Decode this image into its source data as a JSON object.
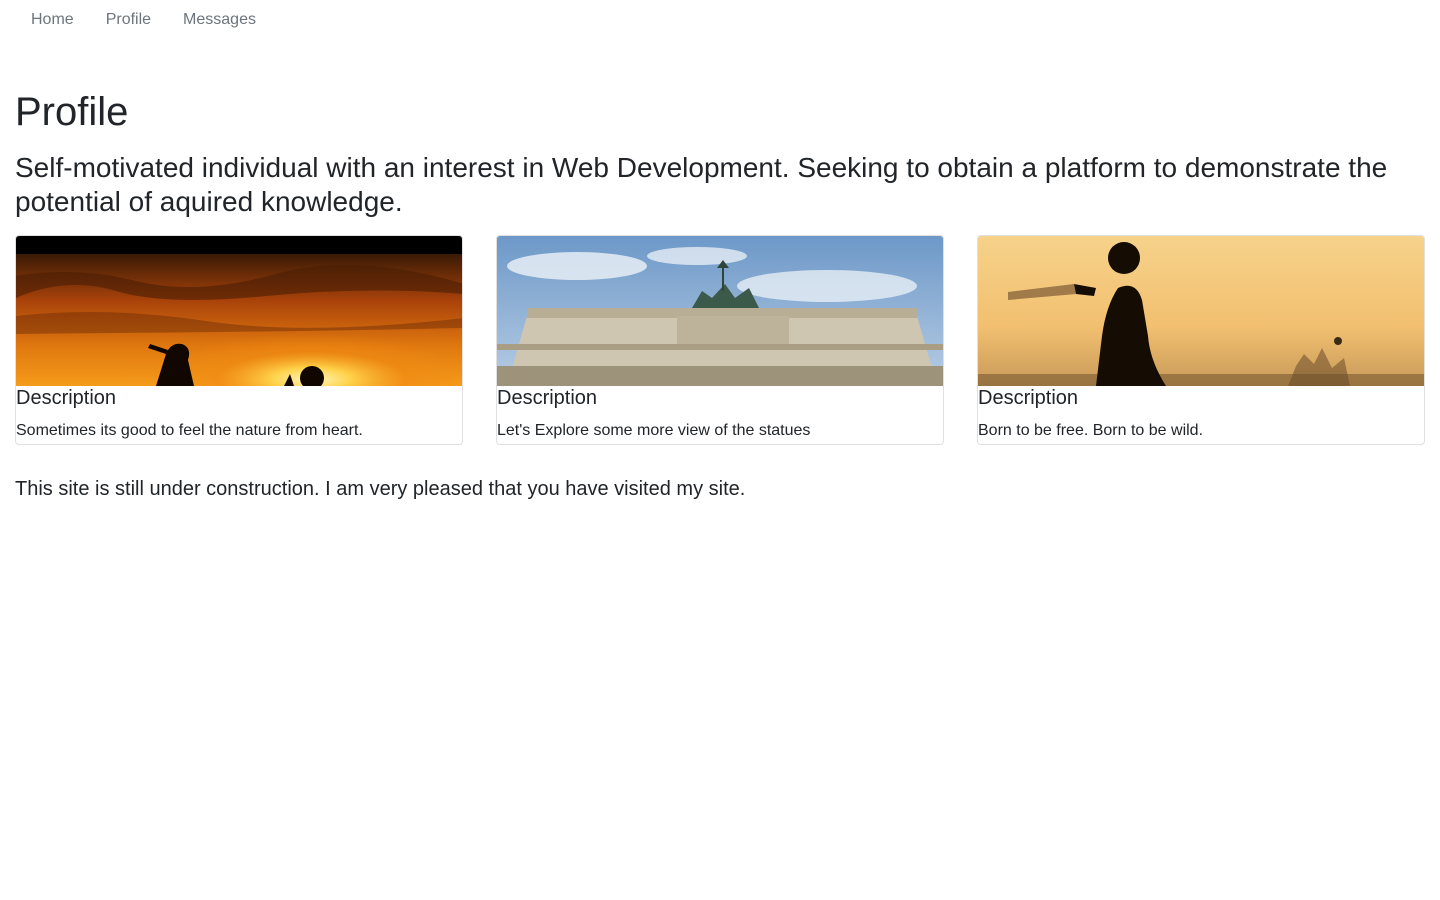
{
  "nav": {
    "items": [
      {
        "label": "Home"
      },
      {
        "label": "Profile"
      },
      {
        "label": "Messages"
      }
    ]
  },
  "page": {
    "title": "Profile",
    "lead": "Self-motivated individual with an interest in Web Development. Seeking to obtain a platform to demonstrate the potential of aquired knowledge."
  },
  "cards": [
    {
      "image": "sunset-silhouette",
      "title": "Description",
      "text": "Sometimes its good to feel the nature from heart."
    },
    {
      "image": "brandenburg-gate",
      "title": "Description",
      "text": "Let's Explore some more view of the statues"
    },
    {
      "image": "cricket-batsman",
      "title": "Description",
      "text": "Born to be free. Born to be wild."
    }
  ],
  "footer": {
    "note": "This site is still under construction. I am very pleased that you have visited my site."
  }
}
